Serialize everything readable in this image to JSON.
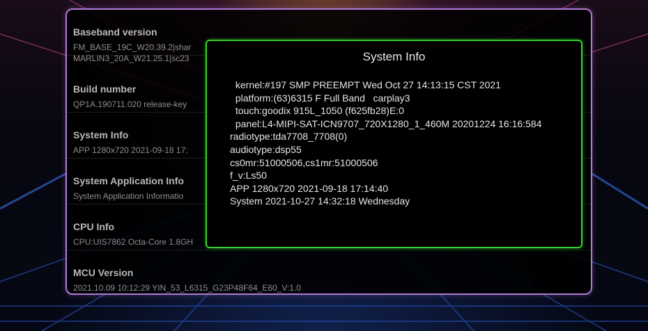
{
  "settings": [
    {
      "title": "Baseband version",
      "sub": "FM_BASE_19C_W20.39.2|shar\nMARLIN3_20A_W21.25.1|sc23"
    },
    {
      "title": "Build number",
      "sub": "QP1A.190711.020 release-key"
    },
    {
      "title": "System Info",
      "sub": "APP 1280x720 2021-09-18 17:"
    },
    {
      "title": "System Application Info",
      "sub": "System Application Informatio"
    },
    {
      "title": "CPU Info",
      "sub": "CPU:UIS7862 Octa-Core 1.8GH"
    },
    {
      "title": "MCU Version",
      "sub": "2021.10.09 10:12:29 YIN_53_L6315_G23P48F64_E60_V:1.0"
    }
  ],
  "dialog": {
    "title": "System Info",
    "lines": [
      " kernel:#197 SMP PREEMPT Wed Oct 27 14:13:15 CST 2021",
      " platform:(63)6315 F Full Band   carplay3",
      " touch:goodix 915L_1050 (f625fb28)E:0",
      " panel:L4-MIPI-SAT-ICN9707_720X1280_1_460M 20201224 16:16:584",
      "radiotype:tda7708_7708(0)",
      "audiotype:dsp55",
      "cs0mr:51000506,cs1mr:51000506",
      "f_v:Ls50",
      "APP 1280x720 2021-09-18 17:14:40",
      "System 2021-10-27 14:32:18 Wednesday"
    ]
  },
  "colors": {
    "panel_border": "#b27ad6",
    "dialog_border": "#37d52a"
  }
}
